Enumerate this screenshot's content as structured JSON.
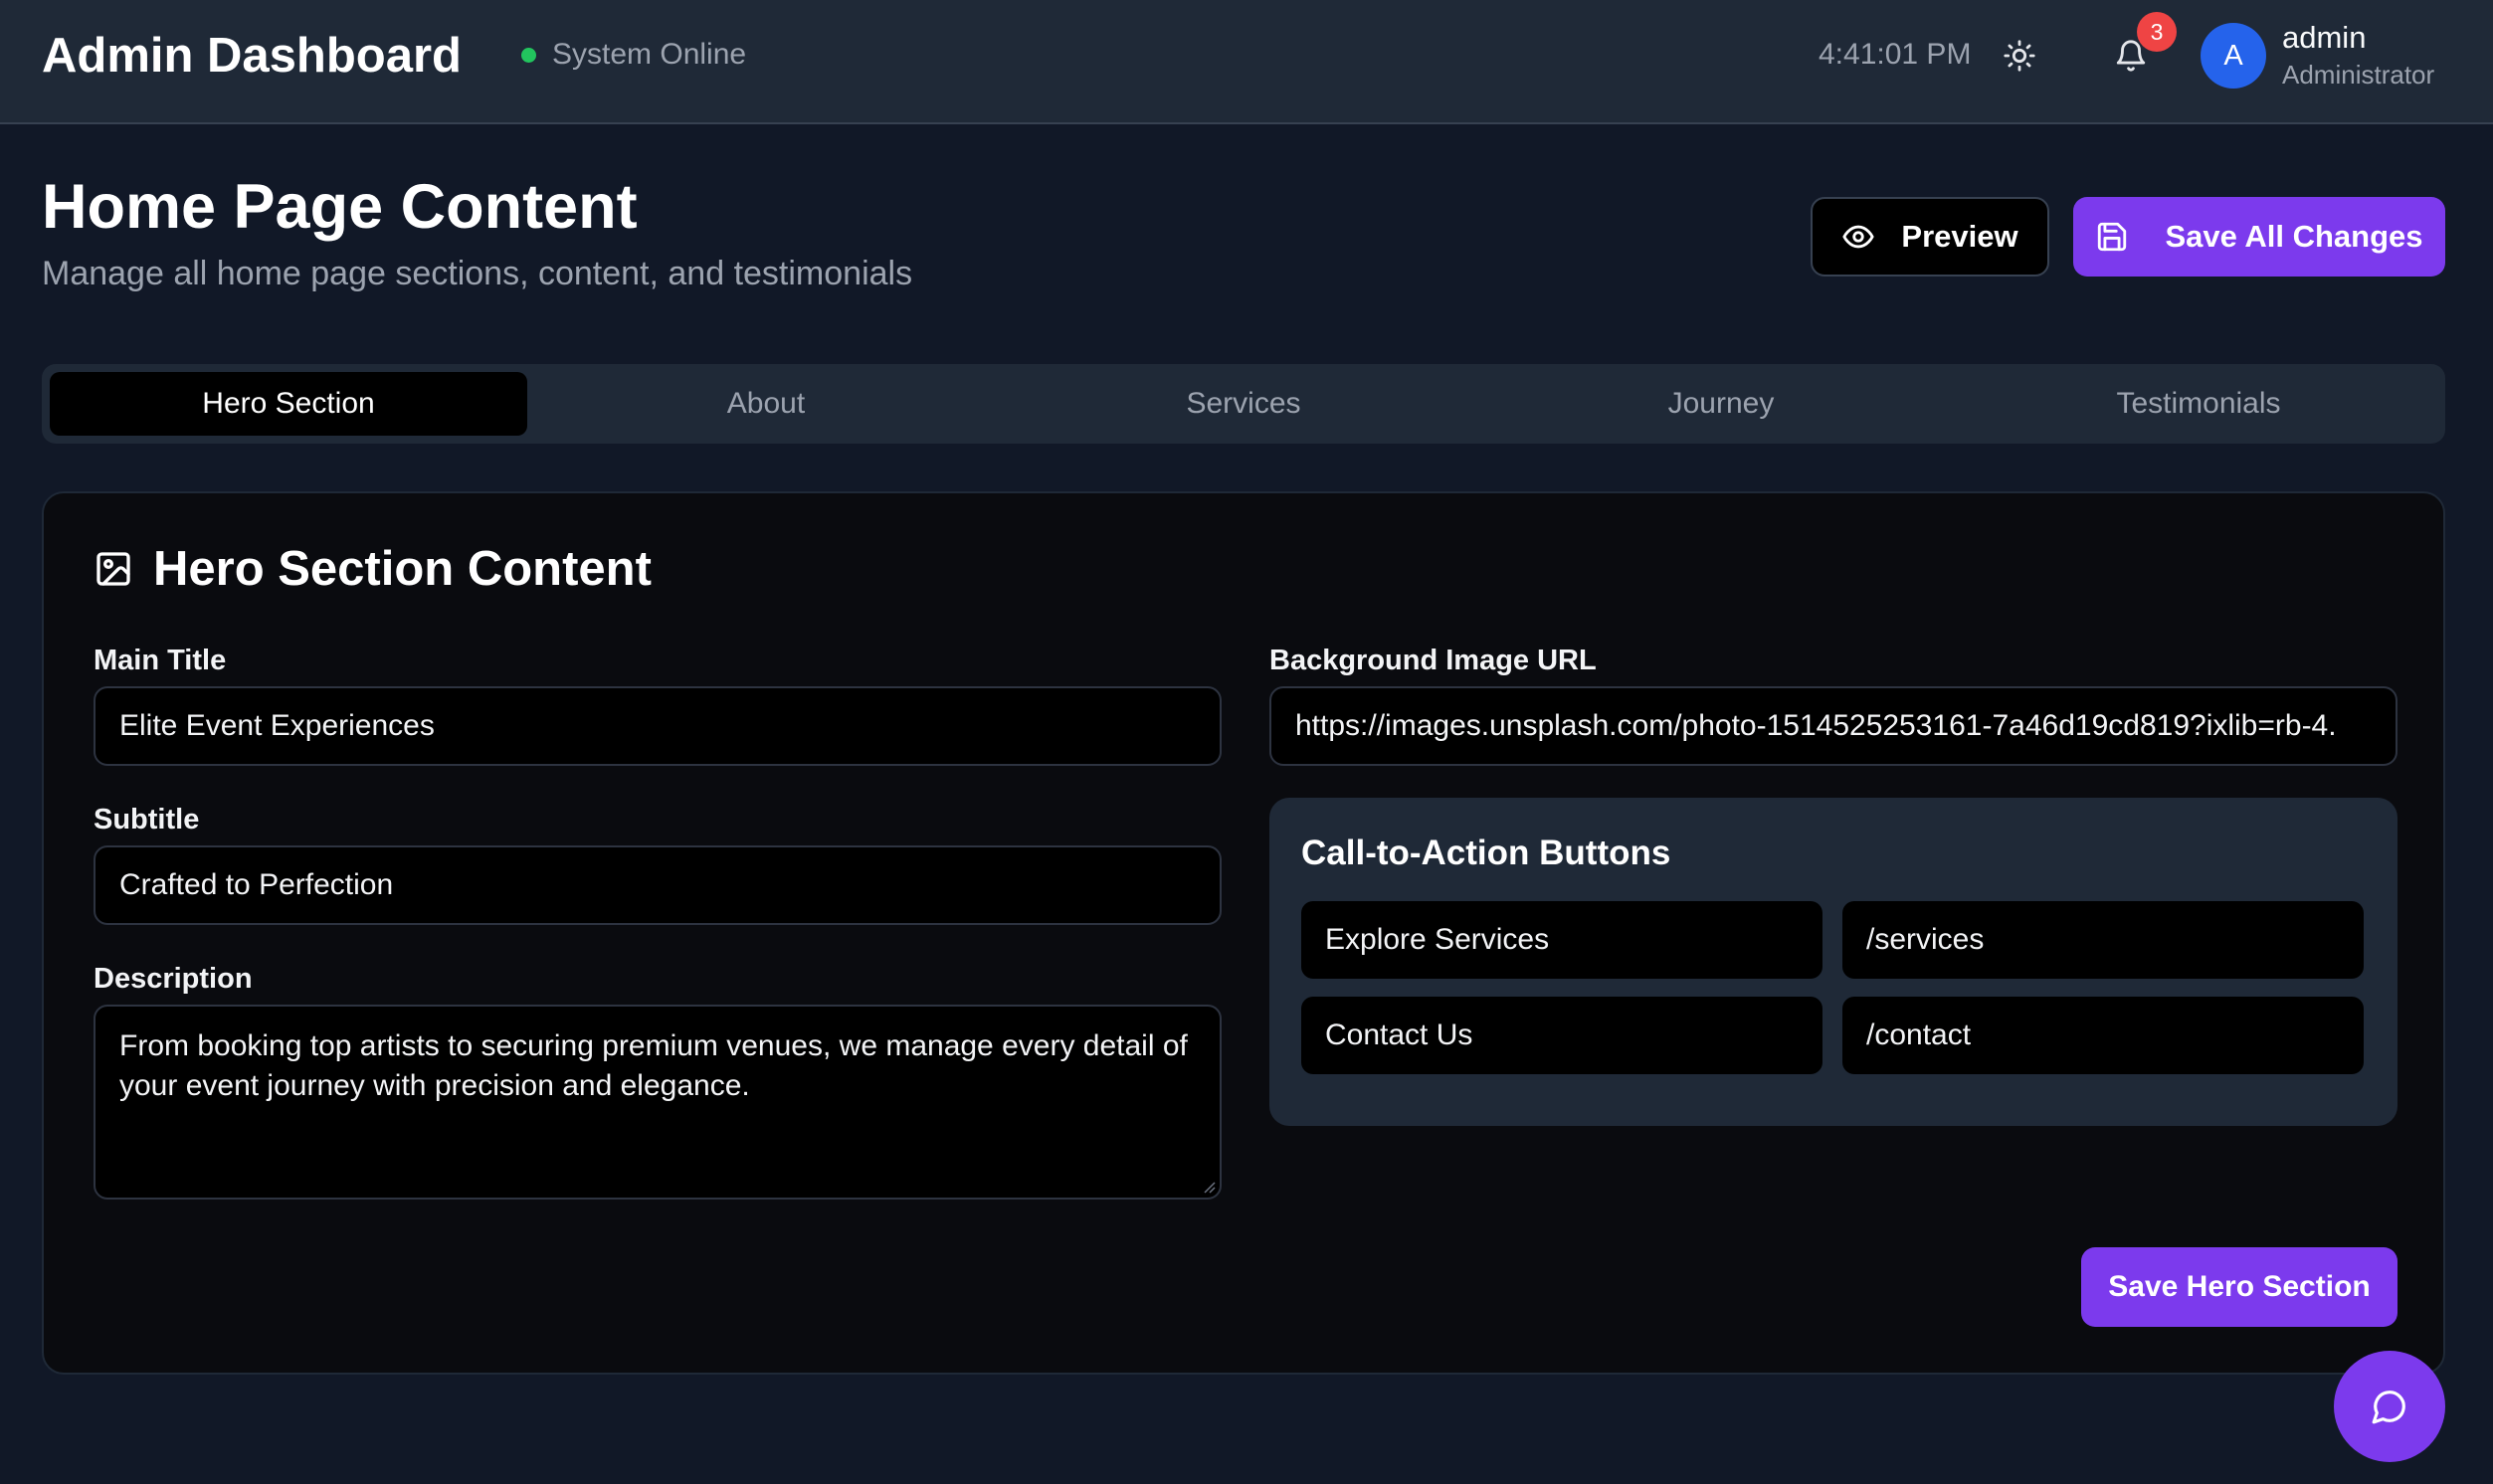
{
  "header": {
    "title": "Admin Dashboard",
    "status_text": "System Online",
    "status_color": "#22c55e",
    "time": "4:41:01 PM",
    "theme_icon": "sun-icon",
    "notifications_icon": "bell-icon",
    "notification_count": "3",
    "user": {
      "avatar_initial": "A",
      "name": "admin",
      "role": "Administrator"
    }
  },
  "page": {
    "title": "Home Page Content",
    "subtitle": "Manage all home page sections, content, and testimonials",
    "preview_label": "Preview",
    "save_all_label": "Save All Changes"
  },
  "tabs": [
    {
      "label": "Hero Section",
      "active": true
    },
    {
      "label": "About",
      "active": false
    },
    {
      "label": "Services",
      "active": false
    },
    {
      "label": "Journey",
      "active": false
    },
    {
      "label": "Testimonials",
      "active": false
    }
  ],
  "hero": {
    "card_title": "Hero Section Content",
    "main_title_label": "Main Title",
    "main_title_value": "Elite Event Experiences",
    "subtitle_label": "Subtitle",
    "subtitle_value": "Crafted to Perfection",
    "description_label": "Description",
    "description_value": "From booking top artists to securing premium venues, we manage every detail of your event journey with precision and elegance.",
    "bg_image_label": "Background Image URL",
    "bg_image_value": "https://images.unsplash.com/photo-1514525253161-7a46d19cd819?ixlib=rb-4.",
    "cta": {
      "title": "Call-to-Action Buttons",
      "buttons": [
        {
          "text": "Explore Services",
          "link": "/services"
        },
        {
          "text": "Contact Us",
          "link": "/contact"
        }
      ]
    },
    "save_label": "Save Hero Section"
  },
  "colors": {
    "accent": "#7c3aed",
    "background": "#111827",
    "notification_badge": "#ef4444",
    "avatar": "#2563eb"
  }
}
